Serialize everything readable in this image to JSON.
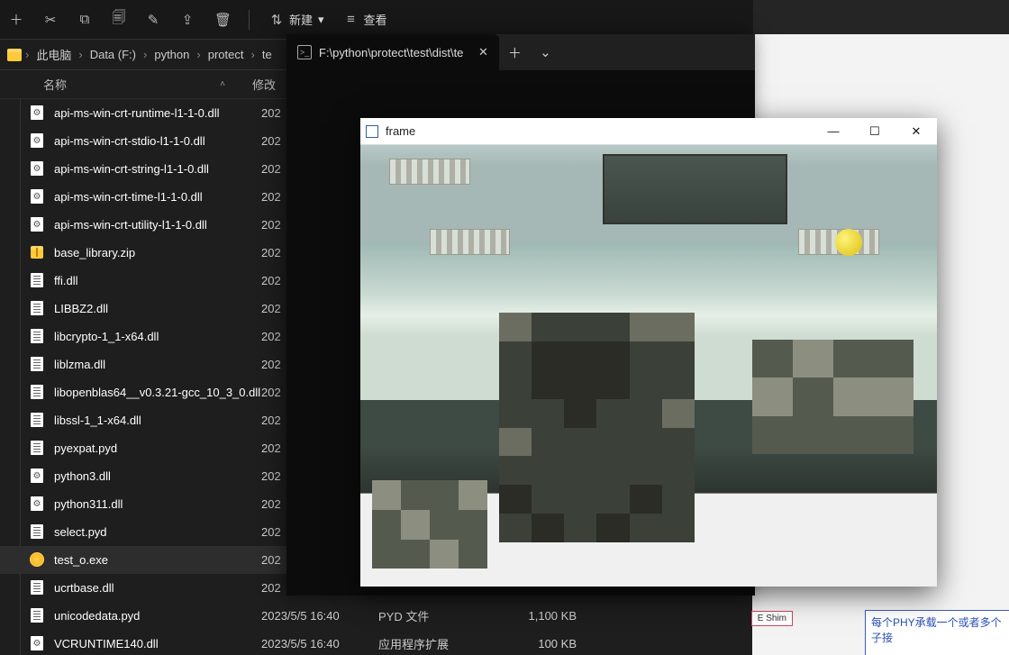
{
  "toolbar": {
    "newMenu": "新建",
    "newSmall": "▾",
    "view": "查看"
  },
  "breadcrumb": {
    "items": [
      "此电脑",
      "Data (F:)",
      "python",
      "protect",
      "te"
    ]
  },
  "columns": {
    "name": "名称",
    "date": "修改",
    "type": "",
    "size": ""
  },
  "files": [
    {
      "icon": "gear",
      "name": "api-ms-win-crt-runtime-l1-1-0.dll",
      "date": "202",
      "type": "",
      "size": ""
    },
    {
      "icon": "gear",
      "name": "api-ms-win-crt-stdio-l1-1-0.dll",
      "date": "202",
      "type": "",
      "size": ""
    },
    {
      "icon": "gear",
      "name": "api-ms-win-crt-string-l1-1-0.dll",
      "date": "202",
      "type": "",
      "size": ""
    },
    {
      "icon": "gear",
      "name": "api-ms-win-crt-time-l1-1-0.dll",
      "date": "202",
      "type": "",
      "size": ""
    },
    {
      "icon": "gear",
      "name": "api-ms-win-crt-utility-l1-1-0.dll",
      "date": "202",
      "type": "",
      "size": ""
    },
    {
      "icon": "zip",
      "name": "base_library.zip",
      "date": "202",
      "type": "",
      "size": ""
    },
    {
      "icon": "dll",
      "name": "ffi.dll",
      "date": "202",
      "type": "",
      "size": ""
    },
    {
      "icon": "dll",
      "name": "LIBBZ2.dll",
      "date": "202",
      "type": "",
      "size": ""
    },
    {
      "icon": "dll",
      "name": "libcrypto-1_1-x64.dll",
      "date": "202",
      "type": "",
      "size": ""
    },
    {
      "icon": "dll",
      "name": "liblzma.dll",
      "date": "202",
      "type": "",
      "size": ""
    },
    {
      "icon": "dll",
      "name": "libopenblas64__v0.3.21-gcc_10_3_0.dll",
      "date": "202",
      "type": "",
      "size": ""
    },
    {
      "icon": "dll",
      "name": "libssl-1_1-x64.dll",
      "date": "202",
      "type": "",
      "size": ""
    },
    {
      "icon": "dll",
      "name": "pyexpat.pyd",
      "date": "202",
      "type": "",
      "size": ""
    },
    {
      "icon": "gear",
      "name": "python3.dll",
      "date": "202",
      "type": "",
      "size": ""
    },
    {
      "icon": "gear",
      "name": "python311.dll",
      "date": "202",
      "type": "",
      "size": ""
    },
    {
      "icon": "dll",
      "name": "select.pyd",
      "date": "202",
      "type": "",
      "size": ""
    },
    {
      "icon": "exe",
      "name": "test_o.exe",
      "date": "202",
      "type": "",
      "size": "",
      "selected": true
    },
    {
      "icon": "dll",
      "name": "ucrtbase.dll",
      "date": "202",
      "type": "",
      "size": ""
    },
    {
      "icon": "dll",
      "name": "unicodedata.pyd",
      "date": "2023/5/5 16:40",
      "type": "PYD 文件",
      "size": "1,100 KB"
    },
    {
      "icon": "gear",
      "name": "VCRUNTIME140.dll",
      "date": "2023/5/5 16:40",
      "type": "应用程序扩展",
      "size": "100 KB"
    }
  ],
  "terminal": {
    "tabTitle": "F:\\python\\protect\\test\\dist\\te",
    "close": "✕",
    "plus": "＋",
    "chevron": "⌄"
  },
  "frameWindow": {
    "title": "frame",
    "minimize": "—",
    "maximize": "☐",
    "close": "✕"
  },
  "rightPanel": {
    "shim": "E Shim",
    "phy": "每个PHY承载一个或者多个子接"
  }
}
